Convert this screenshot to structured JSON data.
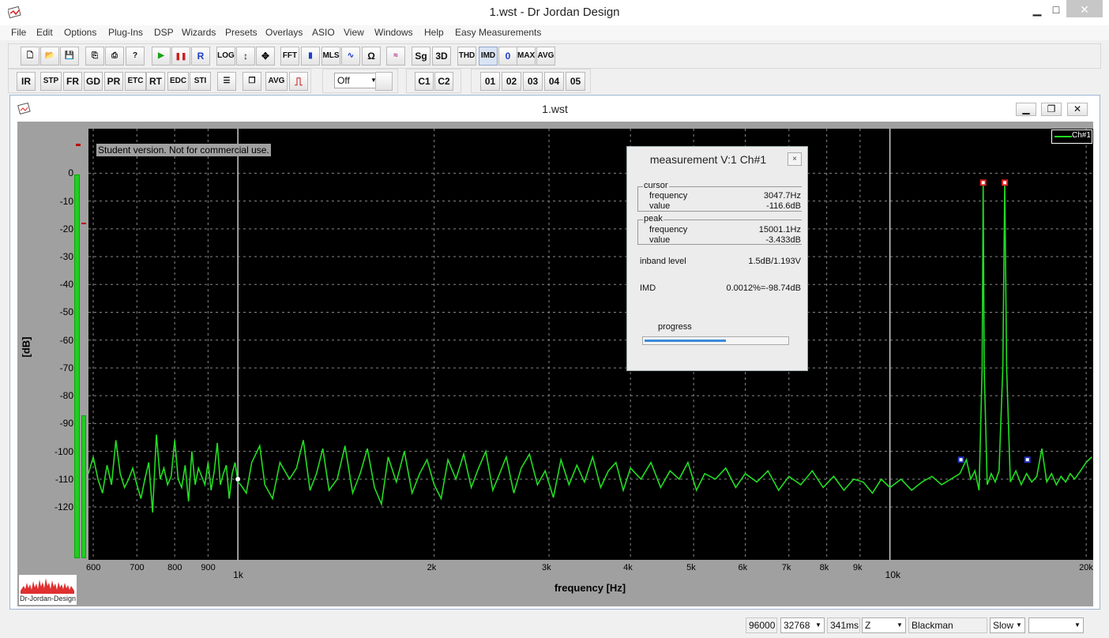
{
  "window": {
    "title": "1.wst - Dr Jordan Design",
    "min": "▁",
    "max": "□",
    "close": "✕"
  },
  "menu": [
    "File",
    "Edit",
    "Options",
    "Plug-Ins",
    "DSP",
    "Wizards",
    "Presets",
    "Overlays",
    "ASIO",
    "View",
    "Windows",
    "Help",
    "Easy Measurements"
  ],
  "toolbar1": [
    "new",
    "open",
    "save",
    "copy",
    "print",
    "help",
    "play",
    "pause",
    "R",
    "LOG",
    "↕",
    "✥",
    "FFT",
    "bars",
    "MLS",
    "wave",
    "Ω",
    "overlay",
    "Sg",
    "3D",
    "THD",
    "IMD",
    "0",
    "MAX",
    "AVG"
  ],
  "toolbar2": {
    "buttons": [
      "IR",
      "STP",
      "FR",
      "GD",
      "PR",
      "ETC",
      "RT",
      "EDC",
      "STI"
    ],
    "avg": "AVG",
    "select_value": "Off",
    "channels": [
      "C1",
      "C2"
    ],
    "presets": [
      "01",
      "02",
      "03",
      "04",
      "05"
    ]
  },
  "child": {
    "title": "1.wst",
    "watermark": "Student version. Not for commercial use.",
    "legend": "Ch#1",
    "logo_text": "Dr-Jordan-Design"
  },
  "measurement": {
    "title": "measurement V:1 Ch#1",
    "close": "×",
    "cursor": {
      "label": "cursor",
      "frequency_label": "frequency",
      "frequency": "3047.7Hz",
      "value_label": "value",
      "value": "-116.6dB"
    },
    "peak": {
      "label": "peak",
      "frequency_label": "frequency",
      "frequency": "15001.1Hz",
      "value_label": "value",
      "value": "-3.433dB"
    },
    "inband_label": "inband level",
    "inband_value": "1.5dB/1.193V",
    "imd_label": "IMD",
    "imd_value": "0.0012%=-98.74dB",
    "progress_label": "progress",
    "progress": 0.57
  },
  "status": {
    "samplerate": "96000",
    "fft_size": "32768",
    "duration": "341ms",
    "weighting": "Z",
    "window_fn": "Blackman",
    "speed": "Slow",
    "extra": ""
  },
  "chart_data": {
    "type": "line",
    "xlabel": "frequency [Hz]",
    "ylabel": "[dB]",
    "xscale": "log",
    "xlim": [
      590,
      20500
    ],
    "ylim": [
      -139,
      16
    ],
    "yticks": [
      0,
      -10,
      -20,
      -30,
      -40,
      -50,
      -60,
      -70,
      -80,
      -90,
      -100,
      -110,
      -120
    ],
    "xticks_minor": [
      {
        "value": 600,
        "label": "600"
      },
      {
        "value": 700,
        "label": "700"
      },
      {
        "value": 800,
        "label": "800"
      },
      {
        "value": 900,
        "label": "900"
      },
      {
        "value": 2000,
        "label": "2k"
      },
      {
        "value": 3000,
        "label": "3k"
      },
      {
        "value": 4000,
        "label": "4k"
      },
      {
        "value": 5000,
        "label": "5k"
      },
      {
        "value": 6000,
        "label": "6k"
      },
      {
        "value": 7000,
        "label": "7k"
      },
      {
        "value": 8000,
        "label": "8k"
      },
      {
        "value": 9000,
        "label": "9k"
      },
      {
        "value": 20000,
        "label": "20k"
      }
    ],
    "xticks_major": [
      {
        "value": 1000,
        "label": "1k"
      },
      {
        "value": 10000,
        "label": "10k"
      }
    ],
    "grid": true,
    "legend_position": "top-right",
    "series": [
      {
        "name": "Ch#1",
        "color": "#22dd22",
        "noise_floor_db": -110,
        "peaks": [
          {
            "freq": 13900,
            "db": -3.4
          },
          {
            "freq": 15001,
            "db": -3.4
          }
        ],
        "points": [
          [
            590,
            -108
          ],
          [
            600,
            -102
          ],
          [
            610,
            -110
          ],
          [
            620,
            -115
          ],
          [
            630,
            -105
          ],
          [
            640,
            -112
          ],
          [
            650,
            -96
          ],
          [
            660,
            -108
          ],
          [
            670,
            -113
          ],
          [
            680,
            -110
          ],
          [
            690,
            -106
          ],
          [
            700,
            -112
          ],
          [
            710,
            -117
          ],
          [
            720,
            -110
          ],
          [
            730,
            -104
          ],
          [
            740,
            -122
          ],
          [
            750,
            -94
          ],
          [
            760,
            -110
          ],
          [
            770,
            -106
          ],
          [
            780,
            -112
          ],
          [
            790,
            -109
          ],
          [
            800,
            -96
          ],
          [
            810,
            -110
          ],
          [
            820,
            -113
          ],
          [
            830,
            -105
          ],
          [
            840,
            -118
          ],
          [
            850,
            -100
          ],
          [
            860,
            -112
          ],
          [
            870,
            -106
          ],
          [
            880,
            -109
          ],
          [
            890,
            -112
          ],
          [
            900,
            -104
          ],
          [
            910,
            -114
          ],
          [
            920,
            -107
          ],
          [
            930,
            -97
          ],
          [
            940,
            -112
          ],
          [
            950,
            -108
          ],
          [
            960,
            -105
          ],
          [
            970,
            -117
          ],
          [
            980,
            -108
          ],
          [
            990,
            -104
          ],
          [
            1000,
            -111
          ],
          [
            1010,
            -112
          ],
          [
            1030,
            -115
          ],
          [
            1050,
            -104
          ],
          [
            1080,
            -98
          ],
          [
            1100,
            -112
          ],
          [
            1130,
            -117
          ],
          [
            1160,
            -104
          ],
          [
            1200,
            -110
          ],
          [
            1230,
            -106
          ],
          [
            1260,
            -96
          ],
          [
            1290,
            -114
          ],
          [
            1320,
            -108
          ],
          [
            1350,
            -99
          ],
          [
            1380,
            -114
          ],
          [
            1420,
            -110
          ],
          [
            1460,
            -98
          ],
          [
            1500,
            -115
          ],
          [
            1540,
            -108
          ],
          [
            1580,
            -99
          ],
          [
            1620,
            -113
          ],
          [
            1660,
            -119
          ],
          [
            1700,
            -102
          ],
          [
            1750,
            -111
          ],
          [
            1800,
            -100
          ],
          [
            1850,
            -115
          ],
          [
            1900,
            -108
          ],
          [
            1950,
            -103
          ],
          [
            2000,
            -112
          ],
          [
            2050,
            -117
          ],
          [
            2100,
            -103
          ],
          [
            2160,
            -110
          ],
          [
            2220,
            -101
          ],
          [
            2280,
            -113
          ],
          [
            2340,
            -106
          ],
          [
            2400,
            -100
          ],
          [
            2460,
            -114
          ],
          [
            2520,
            -108
          ],
          [
            2580,
            -102
          ],
          [
            2650,
            -115
          ],
          [
            2720,
            -106
          ],
          [
            2800,
            -101
          ],
          [
            2880,
            -112
          ],
          [
            2960,
            -107
          ],
          [
            3047,
            -116.6
          ],
          [
            3130,
            -103
          ],
          [
            3220,
            -112
          ],
          [
            3310,
            -105
          ],
          [
            3400,
            -111
          ],
          [
            3500,
            -102
          ],
          [
            3600,
            -113
          ],
          [
            3700,
            -107
          ],
          [
            3800,
            -104
          ],
          [
            3900,
            -114
          ],
          [
            4000,
            -106
          ],
          [
            4150,
            -110
          ],
          [
            4300,
            -104
          ],
          [
            4450,
            -113
          ],
          [
            4600,
            -107
          ],
          [
            4750,
            -110
          ],
          [
            4900,
            -104
          ],
          [
            5050,
            -114
          ],
          [
            5200,
            -108
          ],
          [
            5400,
            -110
          ],
          [
            5600,
            -106
          ],
          [
            5800,
            -113
          ],
          [
            6000,
            -108
          ],
          [
            6250,
            -111
          ],
          [
            6500,
            -107
          ],
          [
            6750,
            -114
          ],
          [
            7000,
            -109
          ],
          [
            7300,
            -112
          ],
          [
            7600,
            -107
          ],
          [
            7900,
            -113
          ],
          [
            8200,
            -109
          ],
          [
            8500,
            -114
          ],
          [
            8800,
            -110
          ],
          [
            9100,
            -111
          ],
          [
            9400,
            -115
          ],
          [
            9700,
            -110
          ],
          [
            10000,
            -113
          ],
          [
            10400,
            -110
          ],
          [
            10800,
            -114
          ],
          [
            11200,
            -111
          ],
          [
            11600,
            -109
          ],
          [
            12000,
            -112
          ],
          [
            12400,
            -110
          ],
          [
            12800,
            -108
          ],
          [
            13100,
            -103
          ],
          [
            13300,
            -110
          ],
          [
            13500,
            -107
          ],
          [
            13700,
            -114
          ],
          [
            13850,
            -70
          ],
          [
            13900,
            -3.4
          ],
          [
            13950,
            -70
          ],
          [
            14100,
            -112
          ],
          [
            14300,
            -108
          ],
          [
            14500,
            -111
          ],
          [
            14700,
            -107
          ],
          [
            14900,
            -70
          ],
          [
            15001,
            -3.4
          ],
          [
            15100,
            -70
          ],
          [
            15300,
            -111
          ],
          [
            15600,
            -107
          ],
          [
            15900,
            -112
          ],
          [
            16200,
            -108
          ],
          [
            16500,
            -111
          ],
          [
            16800,
            -109
          ],
          [
            17100,
            -99
          ],
          [
            17400,
            -111
          ],
          [
            17700,
            -108
          ],
          [
            18000,
            -112
          ],
          [
            18300,
            -109
          ],
          [
            18600,
            -111
          ],
          [
            18900,
            -108
          ],
          [
            19200,
            -110
          ],
          [
            19600,
            -107
          ],
          [
            20000,
            -104
          ],
          [
            20400,
            -102
          ]
        ]
      }
    ],
    "markers": [
      {
        "freq": 13900,
        "db": -3.4,
        "color": "#e02020"
      },
      {
        "freq": 15001,
        "db": -3.4,
        "color": "#e02020"
      },
      {
        "freq": 12850,
        "db": -103,
        "color": "#2030c0"
      },
      {
        "freq": 16250,
        "db": -103,
        "color": "#2030c0"
      },
      {
        "freq": 1000,
        "db": -110,
        "color": "#ffffff"
      }
    ]
  }
}
